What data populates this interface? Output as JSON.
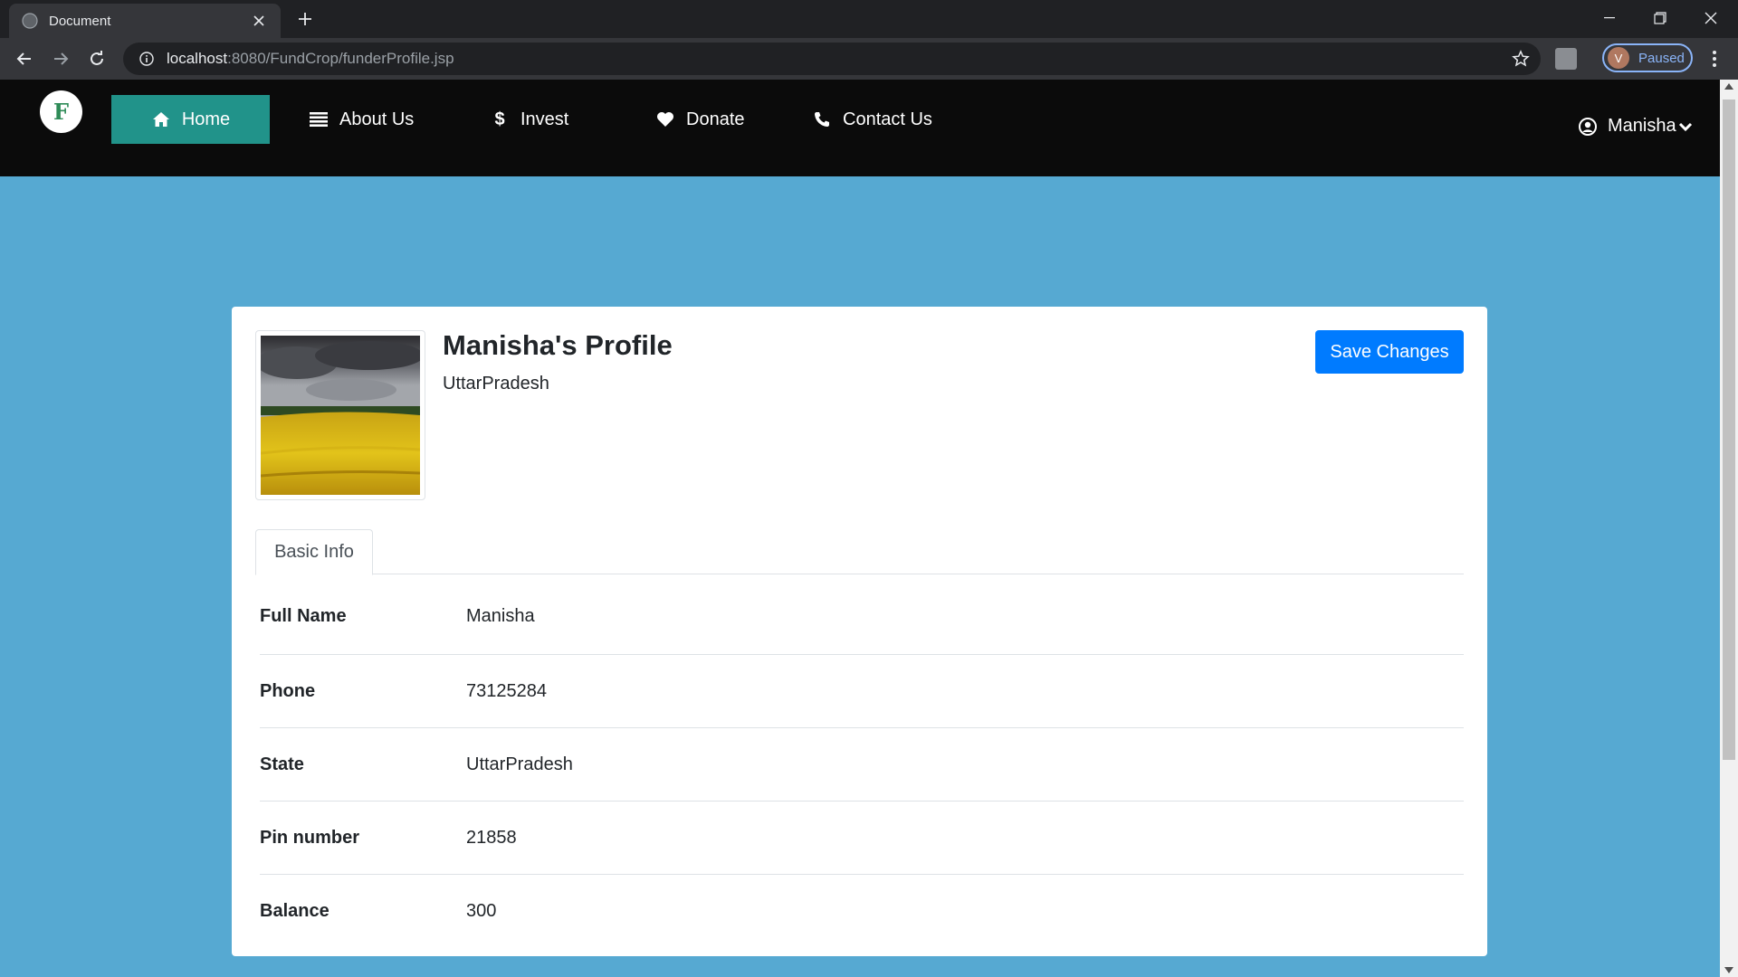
{
  "browser": {
    "tab_title": "Document",
    "url_host": "localhost",
    "url_rest": ":8080/FundCrop/funderProfile.jsp",
    "profile_initial": "V",
    "profile_status": "Paused"
  },
  "site": {
    "logo_letter": "F",
    "nav": [
      {
        "label": "Home",
        "icon": "home-icon",
        "active": true
      },
      {
        "label": "About Us",
        "icon": "list-icon"
      },
      {
        "label": "Invest",
        "icon": "dollar-icon"
      },
      {
        "label": "Donate",
        "icon": "heart-icon"
      },
      {
        "label": "Contact Us",
        "icon": "phone-icon"
      }
    ],
    "user_name": "Manisha",
    "active_color": "#21938a",
    "background_color": "#56a9d2"
  },
  "profile": {
    "title": "Manisha's Profile",
    "subtitle": "UttarPradesh",
    "save_label": "Save Changes",
    "tab_label": "Basic Info",
    "fields": [
      {
        "label": "Full Name",
        "value": "Manisha"
      },
      {
        "label": "Phone",
        "value": "73125284"
      },
      {
        "label": "State",
        "value": "UttarPradesh"
      },
      {
        "label": "Pin number",
        "value": "21858"
      },
      {
        "label": "Balance",
        "value": "300"
      }
    ]
  }
}
